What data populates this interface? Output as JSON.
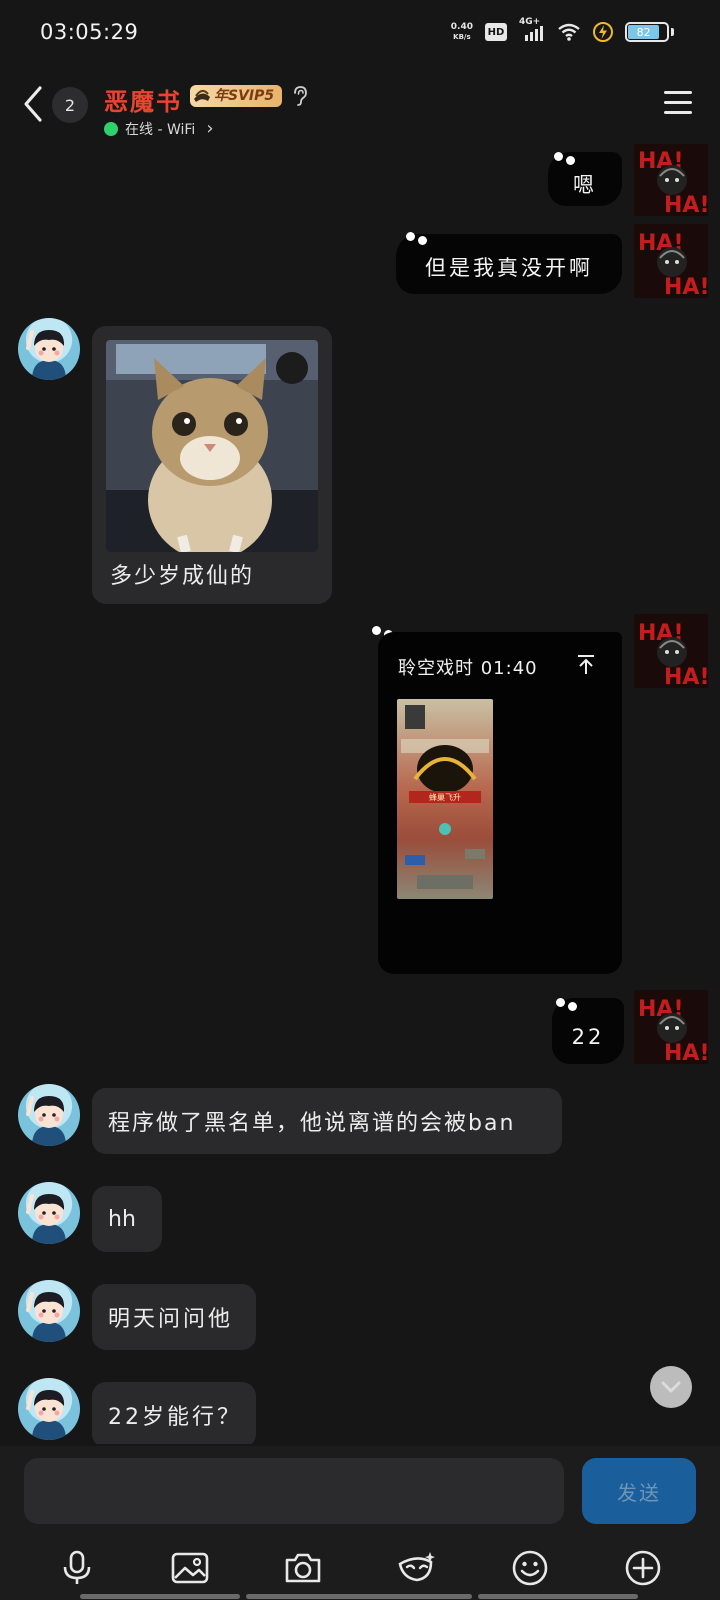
{
  "status_bar": {
    "time": "03:05:29",
    "net_speed_value": "0.40",
    "net_speed_unit": "KB/s",
    "hd_label": "HD",
    "network_label": "4G+",
    "battery_level": "82"
  },
  "header": {
    "unread_count": "2",
    "contact_name": "恶魔书",
    "vip_label": "年SVIP5",
    "presence_text": "在线 - WiFi",
    "presence_chevron": "›"
  },
  "messages": {
    "out_1": "嗯",
    "out_2": "但是我真没开啊",
    "in_image_caption": "多少岁成仙的",
    "voice_card_title": "聆空戏时 01:40",
    "voice_thumb_banner": "蜂巢飞升",
    "out_3": "22",
    "in_2": "程序做了黑名单，他说离谱的会被ban",
    "in_3": "hh",
    "in_4": "明天问问他",
    "in_5": "22岁能行？"
  },
  "input": {
    "placeholder": "",
    "send_label": "发送"
  },
  "icons": {
    "toolbar": [
      "mic-icon",
      "image-icon",
      "camera-icon",
      "mask-icon",
      "emoji-icon",
      "plus-icon"
    ]
  },
  "colors": {
    "name_red": "#e8452e",
    "online_green": "#2fd26a",
    "send_blue": "#1a5f9b"
  }
}
